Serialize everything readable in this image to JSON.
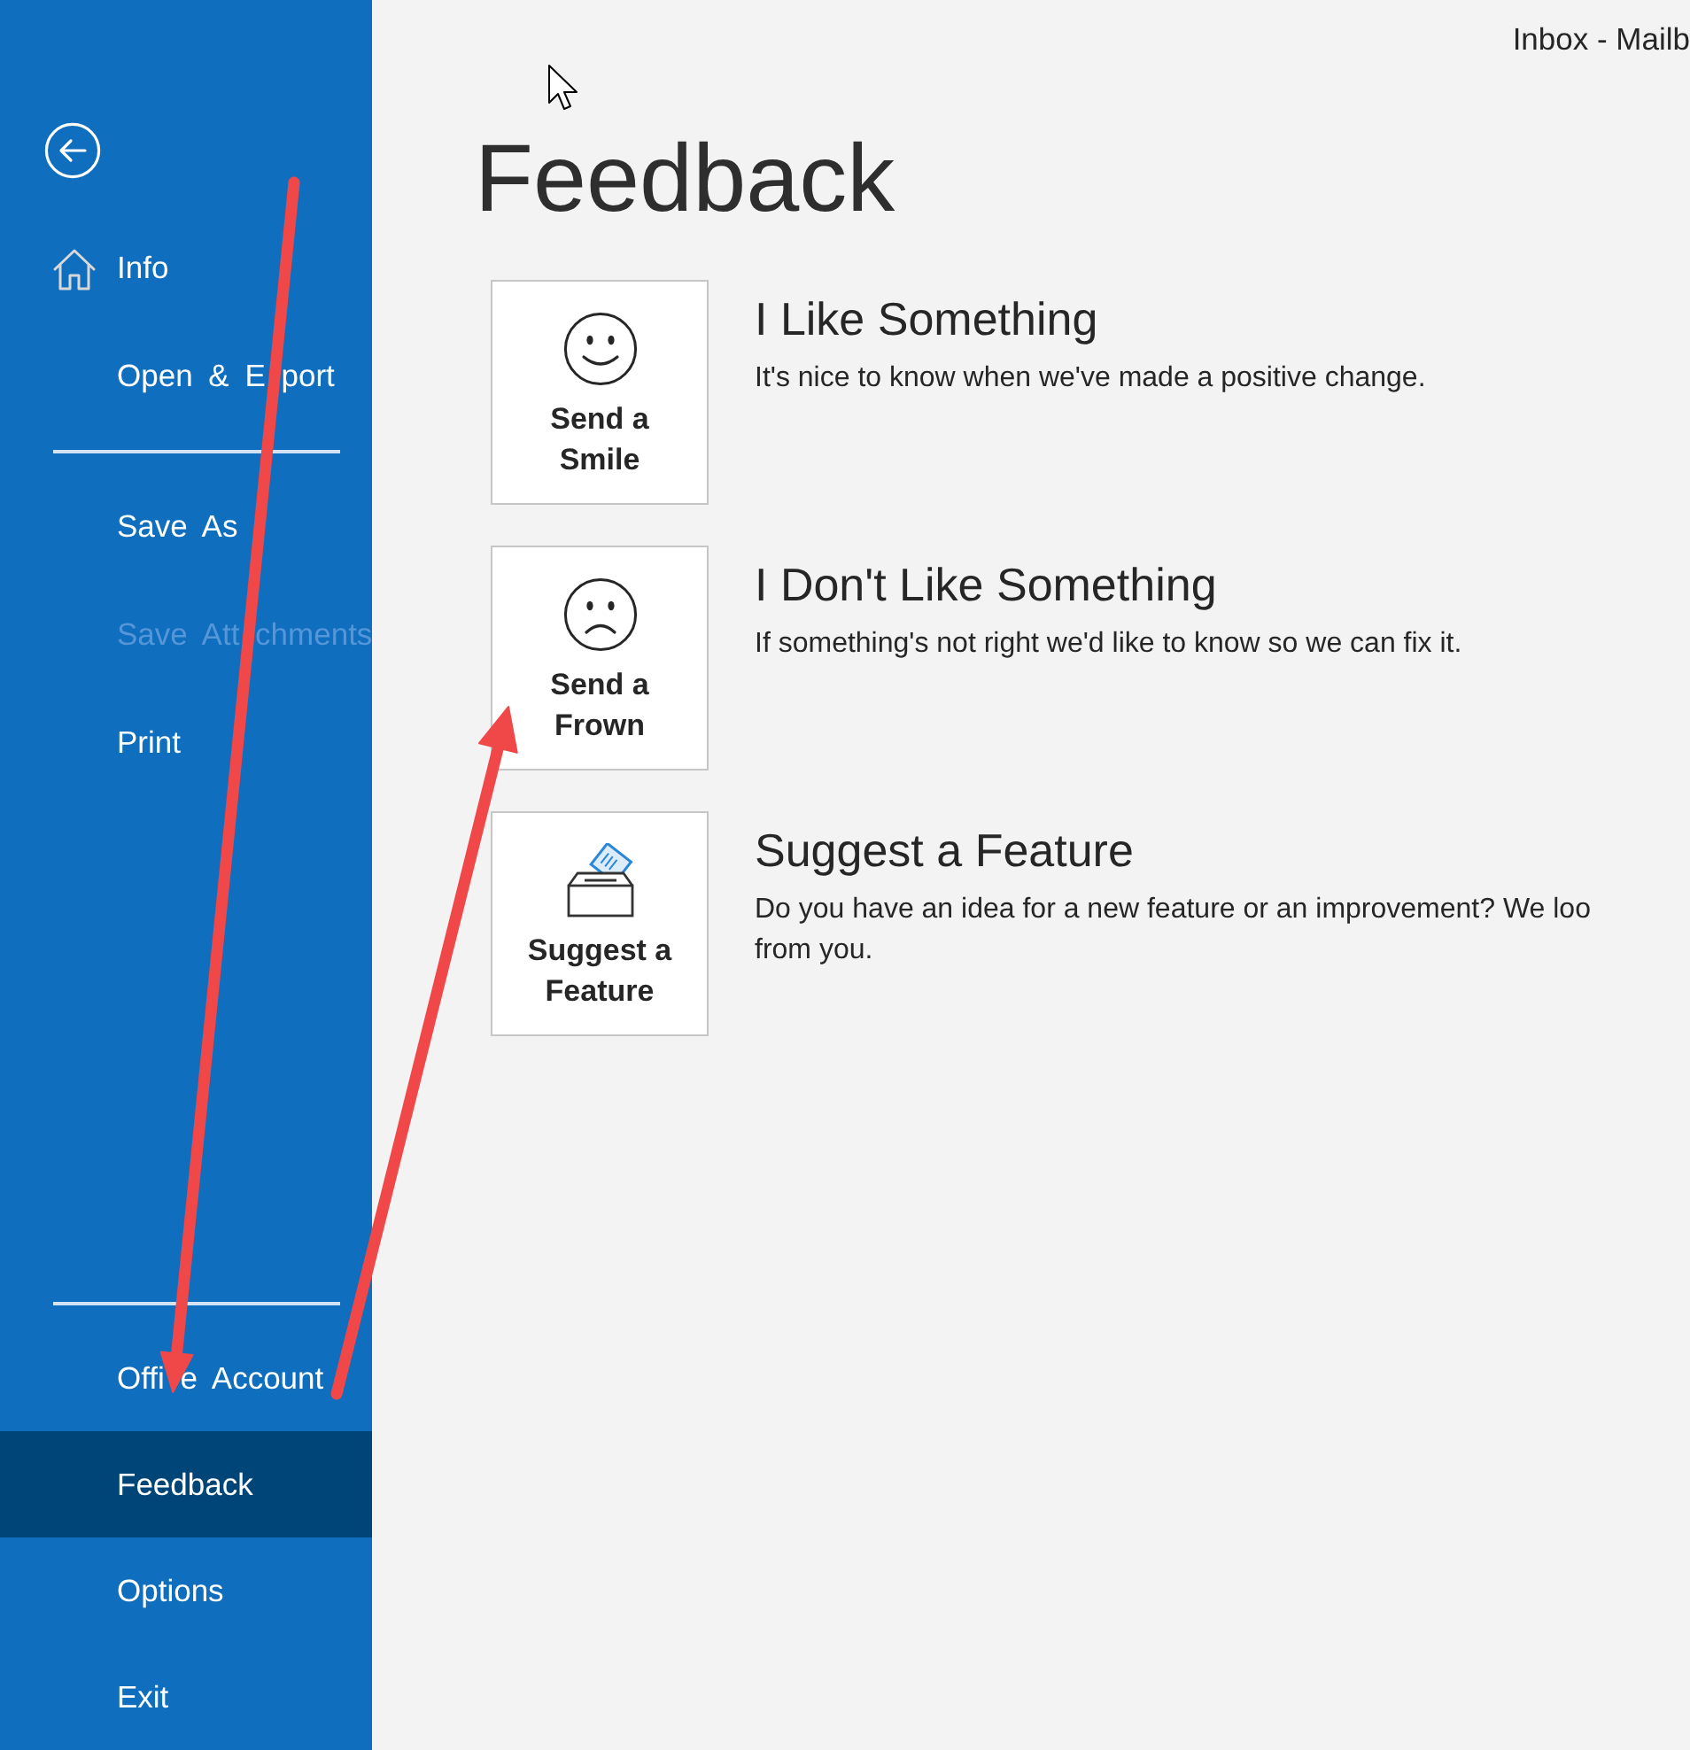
{
  "window": {
    "title": "Inbox - Mailb"
  },
  "sidebar": {
    "sections": [
      {
        "items": [
          {
            "label": "Info",
            "kind": "iconed",
            "selected": false,
            "disabled": false
          },
          {
            "label": "Open & E port",
            "kind": "plain",
            "selected": false,
            "disabled": false
          }
        ]
      },
      {
        "items": [
          {
            "label": "Save As",
            "kind": "plain",
            "selected": false,
            "disabled": false
          },
          {
            "label": "Save Att chments",
            "kind": "plain",
            "selected": false,
            "disabled": true
          },
          {
            "label": "Print",
            "kind": "plain",
            "selected": false,
            "disabled": false
          }
        ]
      },
      {
        "items": [
          {
            "label": "Offi e Account",
            "kind": "plain",
            "selected": false,
            "disabled": false
          },
          {
            "label": "Feedback",
            "kind": "plain",
            "selected": true,
            "disabled": false
          },
          {
            "label": "Options",
            "kind": "plain",
            "selected": false,
            "disabled": false
          },
          {
            "label": "Exit",
            "kind": "plain",
            "selected": false,
            "disabled": false
          }
        ]
      }
    ]
  },
  "page": {
    "heading": "Feedback",
    "options": [
      {
        "kind": "smile",
        "button_label": "Send a Smile",
        "title": "I Like Something",
        "description": [
          "It's nice to know when we've made a positive change."
        ]
      },
      {
        "kind": "frown",
        "button_label": "Send a Frown",
        "title": "I Don't Like Something",
        "description": [
          "If something's not right we'd like to know so we can fix it."
        ]
      },
      {
        "kind": "suggest",
        "button_label": "Suggest a Feature",
        "title": "Suggest a Feature",
        "description": [
          "Do you have an idea for a new feature or an improvement? We loo",
          "from you."
        ]
      }
    ]
  },
  "annotations": [
    {
      "kind": "arrow"
    },
    {
      "kind": "arrow"
    }
  ]
}
